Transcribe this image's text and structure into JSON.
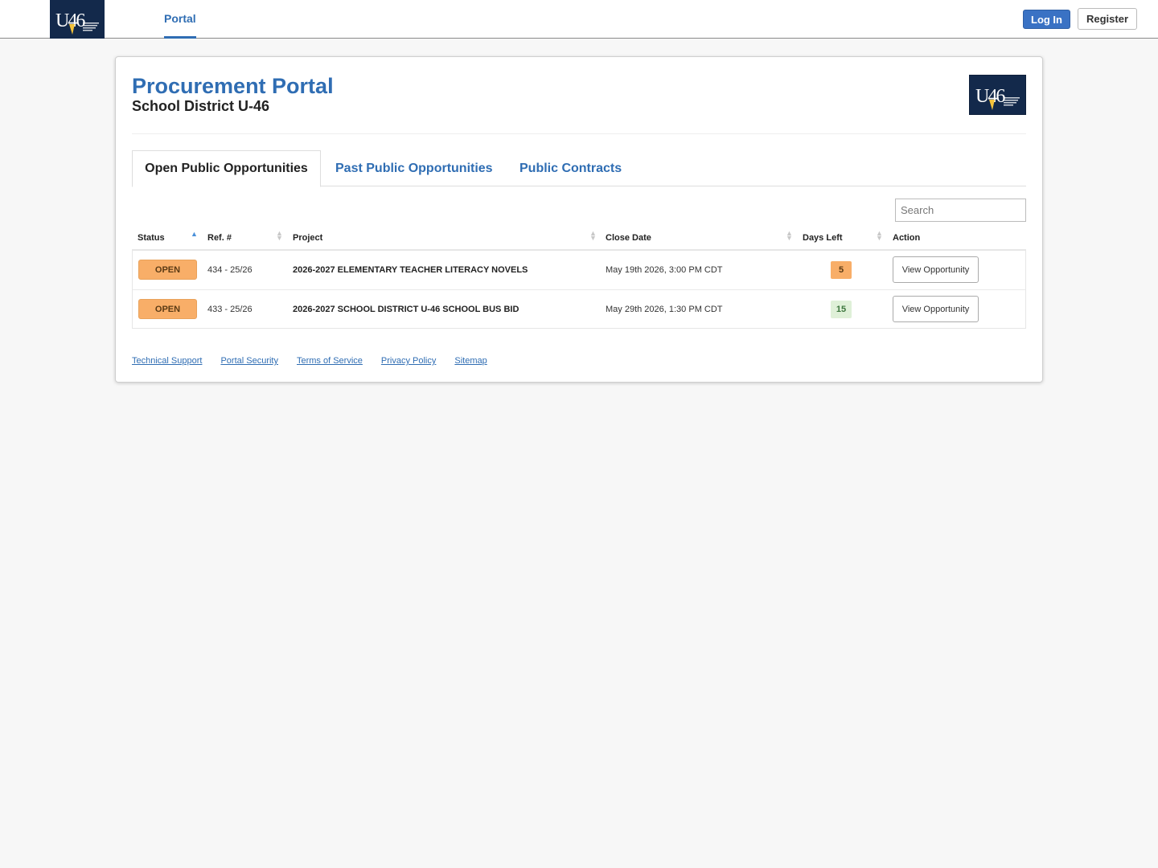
{
  "nav": {
    "logo_text": "U-46",
    "portal_tab": "Portal",
    "login_label": "Log In",
    "register_label": "Register"
  },
  "header": {
    "title": "Procurement Portal",
    "subtitle": "School District U-46",
    "logo_text": "U-46"
  },
  "tabs": [
    {
      "label": "Open Public Opportunities",
      "active": true
    },
    {
      "label": "Past Public Opportunities",
      "active": false
    },
    {
      "label": "Public Contracts",
      "active": false
    }
  ],
  "search": {
    "placeholder": "Search"
  },
  "table": {
    "columns": [
      "Status",
      "Ref. #",
      "Project",
      "Close Date",
      "Days Left",
      "Action"
    ],
    "rows": [
      {
        "status": "OPEN",
        "ref": "434 - 25/26",
        "project": "2026-2027 ELEMENTARY TEACHER LITERACY NOVELS",
        "close_date": "May 19th 2026, 3:00 PM CDT",
        "days_left": "5",
        "action": "View Opportunity"
      },
      {
        "status": "OPEN",
        "ref": "433 - 25/26",
        "project": "2026-2027 SCHOOL DISTRICT U-46 SCHOOL BUS BID",
        "close_date": "May 29th 2026, 1:30 PM CDT",
        "days_left": "15",
        "action": "View Opportunity"
      }
    ]
  },
  "footer": {
    "links": [
      "Technical Support",
      "Portal Security",
      "Terms of Service",
      "Privacy Policy",
      "Sitemap"
    ]
  },
  "colors": {
    "accent": "#2f6db3",
    "login_button": "#3a72c4",
    "status_open": "#f8ae68",
    "days_warning": "#f8ae68",
    "days_ok": "#dff0d8",
    "logo_bg": "#13294b"
  },
  "icons": {
    "sort_ascending": "sort-asc-icon",
    "sort_both": "sort-both-icon"
  }
}
